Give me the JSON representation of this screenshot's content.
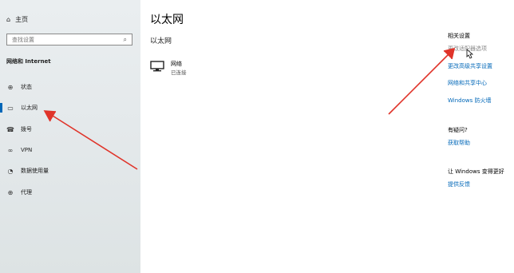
{
  "sidebar": {
    "home_label": "主页",
    "search_placeholder": "查找设置",
    "section_title": "网络和 Internet",
    "items": [
      {
        "label": "状态",
        "icon": "status-icon"
      },
      {
        "label": "以太网",
        "icon": "ethernet-icon",
        "active": true
      },
      {
        "label": "拨号",
        "icon": "dialup-icon"
      },
      {
        "label": "VPN",
        "icon": "vpn-icon"
      },
      {
        "label": "数据使用量",
        "icon": "data-usage-icon"
      },
      {
        "label": "代理",
        "icon": "proxy-icon"
      }
    ]
  },
  "main": {
    "title": "以太网",
    "subtitle": "以太网",
    "network": {
      "name": "网络",
      "status": "已连接",
      "icon": "monitor-icon"
    }
  },
  "related": {
    "title": "相关设置",
    "links": [
      "更改适配器选项",
      "更改高级共享设置",
      "网络和共享中心",
      "Windows 防火墙"
    ]
  },
  "help": {
    "title": "有疑问?",
    "link": "获取帮助"
  },
  "feedback": {
    "title": "让 Windows 变得更好",
    "link": "提供反馈"
  },
  "colors": {
    "accent": "#0067b8",
    "annotation_arrow": "#e0342a",
    "sidebar_bg": "#e6eaec"
  }
}
